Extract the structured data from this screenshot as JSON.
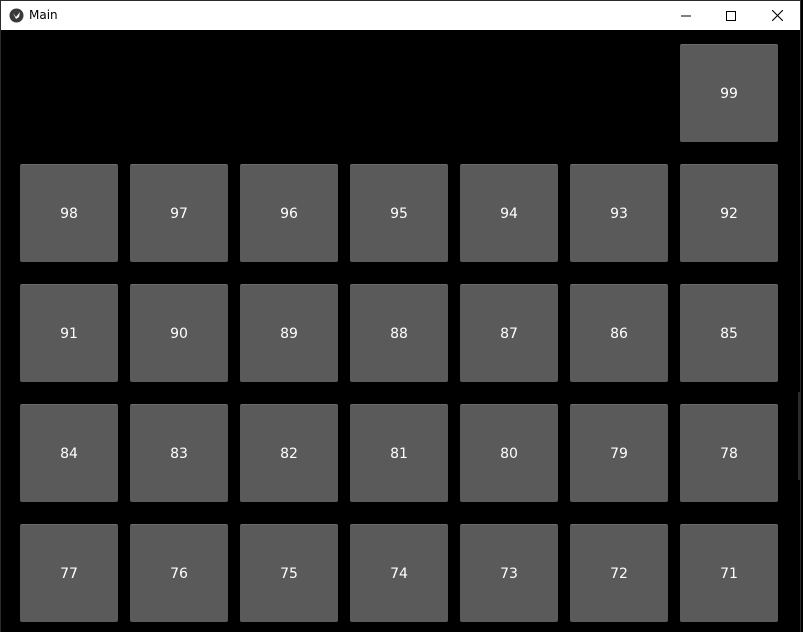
{
  "window": {
    "title": "Main",
    "controls": {
      "minimize": "minimize",
      "maximize": "maximize",
      "close": "close"
    }
  },
  "icons": {
    "app": "kivy-logo-icon",
    "minimize": "minimize-icon",
    "maximize": "maximize-icon",
    "close": "close-icon"
  },
  "colors": {
    "background": "#000000",
    "tile": "#5a5a5a",
    "tile_text": "#ffffff",
    "titlebar": "#ffffff"
  },
  "grid": {
    "rows": [
      [
        "99"
      ],
      [
        "98",
        "97",
        "96",
        "95",
        "94",
        "93",
        "92"
      ],
      [
        "91",
        "90",
        "89",
        "88",
        "87",
        "86",
        "85"
      ],
      [
        "84",
        "83",
        "82",
        "81",
        "80",
        "79",
        "78"
      ],
      [
        "77",
        "76",
        "75",
        "74",
        "73",
        "72",
        "71"
      ]
    ]
  }
}
